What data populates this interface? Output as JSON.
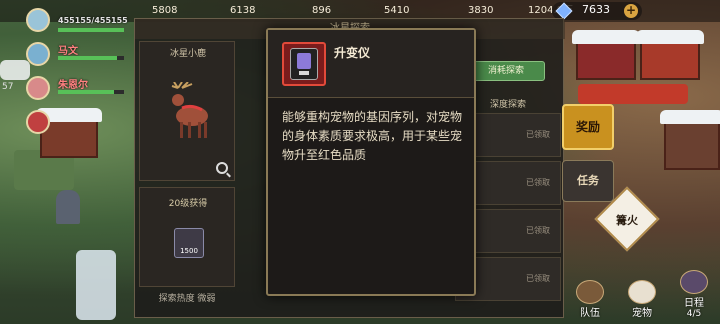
{
  "topbar": {
    "resources": [
      "5808",
      "6138",
      "896",
      "5410",
      "3830",
      "1204.8万"
    ],
    "gems": "7633",
    "plus": "+"
  },
  "players": [
    {
      "level": "",
      "name": "",
      "hp_text": "455155/455155",
      "hp": 1.0
    },
    {
      "level": "",
      "name": "马文",
      "hp_text": "",
      "hp": 0.9
    },
    {
      "level": "57",
      "name": "朱恩尔",
      "hp_text": "",
      "hp": 0.85
    },
    {
      "level": "",
      "name": "",
      "hp_text": "",
      "hp": 0.0
    }
  ],
  "main_panel": {
    "title": "冰星探索",
    "pet_name": "冰星小鹿",
    "reward_title": "20级获得",
    "reward_count": "1500",
    "heat_label": "探索热度 微弱",
    "explore_button": "消耗探索",
    "depth_title": "深度探索",
    "claims": [
      "已领取",
      "已领取",
      "已领取",
      "已领取",
      "已领取"
    ]
  },
  "side": {
    "reward": "奖励",
    "task": "任务",
    "bonfire": "篝火",
    "bottom_buttons": [
      "队伍",
      "宠物",
      "日程"
    ],
    "schedule_progress": "4/5"
  },
  "dialog": {
    "item_name": "升变仪",
    "description": "能够重构宠物的基因序列，对宠物的身体素质要求极高，用于某些宠物升至红色品质"
  }
}
